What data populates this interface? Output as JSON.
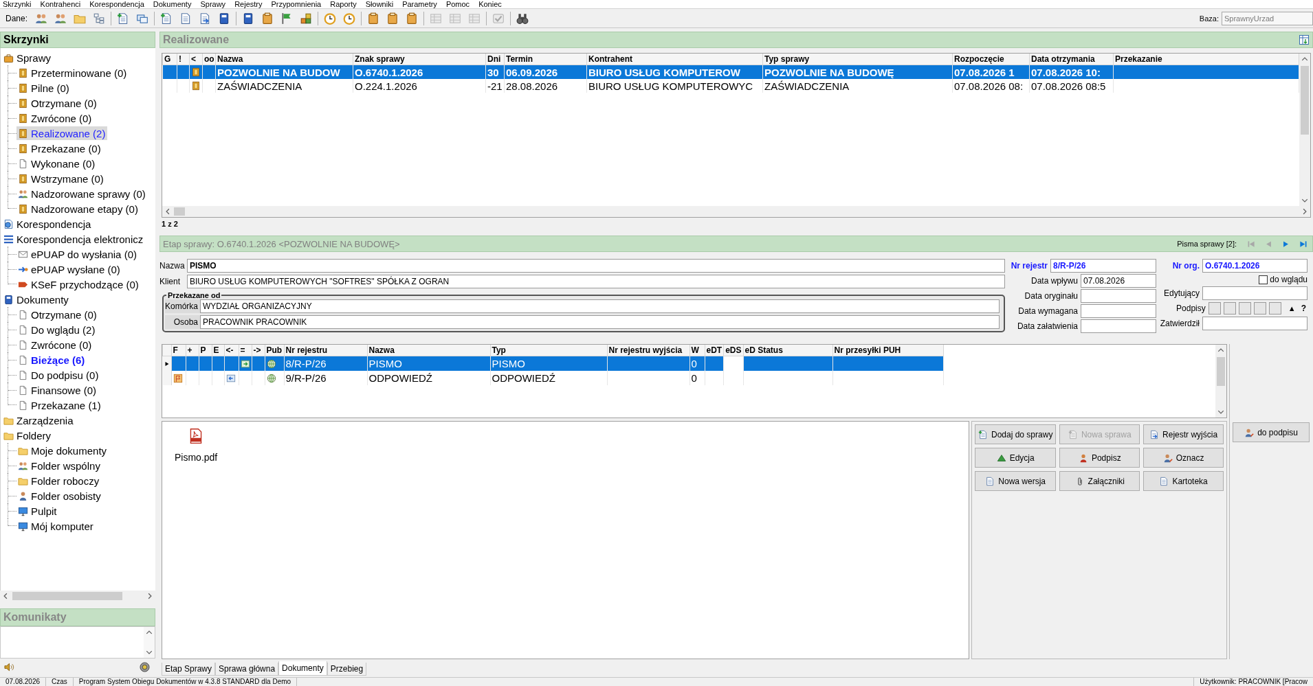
{
  "menu": [
    "Skrzynki",
    "Kontrahenci",
    "Korespondencja",
    "Dokumenty",
    "Sprawy",
    "Rejestry",
    "Przypomnienia",
    "Raporty",
    "Słowniki",
    "Parametry",
    "Pomoc",
    "Koniec"
  ],
  "toolbar": {
    "label": "Dane:",
    "groups": [
      {
        "buttons": [
          {
            "disabled": false
          },
          {
            "disabled": false
          },
          {
            "disabled": false
          },
          {
            "disabled": false
          }
        ]
      },
      {
        "buttons": [
          {
            "disabled": false
          },
          {
            "disabled": false
          }
        ]
      },
      {
        "buttons": [
          {
            "disabled": false
          },
          {
            "disabled": false
          },
          {
            "disabled": false
          },
          {
            "disabled": false
          }
        ]
      },
      {
        "buttons": [
          {
            "disabled": false
          },
          {
            "disabled": false
          },
          {
            "disabled": false
          },
          {
            "disabled": false
          }
        ]
      },
      {
        "buttons": [
          {
            "disabled": false
          },
          {
            "disabled": false
          }
        ]
      },
      {
        "buttons": [
          {
            "disabled": false
          },
          {
            "disabled": false
          },
          {
            "disabled": false
          }
        ]
      },
      {
        "buttons": [
          {
            "disabled": true
          },
          {
            "disabled": true
          },
          {
            "disabled": true
          }
        ]
      },
      {
        "buttons": [
          {
            "disabled": true
          }
        ]
      },
      {
        "buttons": [
          {
            "disabled": false
          }
        ]
      }
    ],
    "database": {
      "label": "Baza:",
      "value": "SprawnyUrzad",
      "disabled": true
    }
  },
  "sidebar": {
    "title": "Skrzynki",
    "tree": [
      {
        "label": "Sprawy",
        "selected": false,
        "bold": false,
        "children": [
          {
            "label": "Przeterminowane (0)",
            "selected": false,
            "bold": false
          },
          {
            "label": "Pilne (0)",
            "selected": false,
            "bold": false
          },
          {
            "label": "Otrzymane (0)",
            "selected": false,
            "bold": false
          },
          {
            "label": "Zwrócone (0)",
            "selected": false,
            "bold": false
          },
          {
            "label": "Realizowane (2)",
            "selected": true,
            "bold": false
          },
          {
            "label": "Przekazane (0)",
            "selected": false,
            "bold": false
          },
          {
            "label": "Wykonane (0)",
            "selected": false,
            "bold": false
          },
          {
            "label": "Wstrzymane (0)",
            "selected": false,
            "bold": false
          },
          {
            "label": "Nadzorowane sprawy (0)",
            "selected": false,
            "bold": false
          },
          {
            "label": "Nadzorowane etapy (0)",
            "selected": false,
            "bold": false
          }
        ]
      },
      {
        "label": "Korespondencja",
        "selected": false,
        "bold": false
      },
      {
        "label": "Korespondencja elektronicz",
        "selected": false,
        "bold": false,
        "children": [
          {
            "label": "ePUAP do wysłania (0)",
            "selected": false,
            "bold": false
          },
          {
            "label": "ePUAP wysłane (0)",
            "selected": false,
            "bold": false
          },
          {
            "label": "KSeF przychodzące (0)",
            "selected": false,
            "bold": false
          }
        ]
      },
      {
        "label": "Dokumenty",
        "selected": false,
        "bold": false,
        "children": [
          {
            "label": "Otrzymane (0)",
            "selected": false,
            "bold": false
          },
          {
            "label": "Do wglądu (2)",
            "selected": false,
            "bold": false
          },
          {
            "label": "Zwrócone (0)",
            "selected": false,
            "bold": false
          },
          {
            "label": "Bieżące (6)",
            "selected": false,
            "bold": true
          },
          {
            "label": "Do podpisu (0)",
            "selected": false,
            "bold": false
          },
          {
            "label": "Finansowe (0)",
            "selected": false,
            "bold": false
          },
          {
            "label": "Przekazane (1)",
            "selected": false,
            "bold": false
          }
        ]
      },
      {
        "label": "Zarządzenia",
        "selected": false,
        "bold": false
      },
      {
        "label": "Foldery",
        "selected": false,
        "bold": false,
        "children": [
          {
            "label": "Moje dokumenty",
            "selected": false,
            "bold": false
          },
          {
            "label": "Folder wspólny",
            "selected": false,
            "bold": false
          },
          {
            "label": "Folder roboczy",
            "selected": false,
            "bold": false
          },
          {
            "label": "Folder osobisty",
            "selected": false,
            "bold": false
          },
          {
            "label": "Pulpit",
            "selected": false,
            "bold": false
          },
          {
            "label": "Mój komputer",
            "selected": false,
            "bold": false
          }
        ]
      }
    ],
    "messages": {
      "title": "Komunikaty"
    }
  },
  "cases": {
    "title": "Realizowane",
    "columns": [
      "G",
      "!",
      "<",
      "oo",
      "Nazwa",
      "Znak sprawy",
      "Dni",
      "Termin",
      "Kontrahent",
      "Typ sprawy",
      "Rozpoczęcie",
      "Data otrzymania",
      "Przekazanie"
    ],
    "rows": [
      {
        "selected": true,
        "name": "POZWOLNIE NA BUDOW",
        "case_number": "O.6740.1.2026",
        "days": "30",
        "deadline": "06.09.2026",
        "contractor": "BIURO USŁUG KOMPUTEROW",
        "case_type": "POZWOLNIE NA BUDOWĘ",
        "started": "07.08.2026 1",
        "received": "07.08.2026 10:"
      },
      {
        "selected": false,
        "name": "ZAŚWIADCZENIA",
        "case_number": "O.224.1.2026",
        "days": "-21",
        "deadline": "28.08.2026",
        "contractor": "BIURO USŁUG KOMPUTEROWYC",
        "case_type": "ZAŚWIADCZENIA",
        "started": "07.08.2026 08:",
        "received": "07.08.2026 08:5"
      }
    ],
    "count": "1 z 2"
  },
  "stage": {
    "title": "Etap sprawy: O.6740.1.2026 <POZWOLNIE NA BUDOWĘ>",
    "letters_label": "Pisma sprawy [2]:",
    "nav": [
      {
        "disabled": true
      },
      {
        "disabled": true
      },
      {
        "disabled": false
      },
      {
        "disabled": false
      }
    ]
  },
  "form": {
    "fields": [
      {
        "label": "Nazwa",
        "value": "PISMO",
        "emphasis": true
      },
      {
        "label": "Klient",
        "value": "BIURO USŁUG KOMPUTEROWYCH \"SOFTRES\" SPÓŁKA Z OGRAN",
        "emphasis": false
      }
    ],
    "group": {
      "title": "Przekazane od",
      "fields": [
        {
          "label": "Komórka",
          "value": "WYDZIAŁ ORGANIZACYJNY"
        },
        {
          "label": "Osoba",
          "value": "PRACOWNIK PRACOWNIK"
        }
      ]
    },
    "dates": [
      {
        "label": "Nr rejestr",
        "value": "8/R-P/26",
        "emphasis": true
      },
      {
        "label": "Data wpływu",
        "value": "07.08.2026",
        "emphasis": false
      },
      {
        "label": "Data oryginału",
        "emphasis": false
      },
      {
        "label": "Data wymagana",
        "emphasis": false
      },
      {
        "label": "Data załatwienia",
        "emphasis": false
      }
    ],
    "side": [
      {
        "kind": "field",
        "label": "Nr org.",
        "value": "O.6740.1.2026",
        "emphasis": true
      },
      {
        "kind": "checkbox",
        "label": "do wglądu",
        "checked": false
      },
      {
        "kind": "field",
        "label": "Edytujący",
        "emphasis": false
      },
      {
        "kind": "signatures",
        "label": "Podpisy",
        "slots": [
          {
            "signed": false
          },
          {
            "signed": false
          },
          {
            "signed": false
          },
          {
            "signed": false
          },
          {
            "signed": false
          }
        ],
        "arrow": "▲",
        "question": "?"
      },
      {
        "kind": "field",
        "label": "Zatwierdził",
        "emphasis": false
      }
    ]
  },
  "documents": {
    "columns": [
      "F",
      "+",
      "P",
      "E",
      "<-",
      "=",
      "->",
      "Pub",
      "Nr rejestru",
      "Nazwa",
      "Typ",
      "Nr rejestru wyjścia",
      "W",
      "eDT",
      "eDS",
      "eD Status",
      "Nr przesyłki PUH"
    ],
    "rows": [
      {
        "selected": true,
        "flagged": false,
        "arrow_in": false,
        "linked": true,
        "published": true,
        "register_no": "8/R-P/26",
        "name": "PISMO",
        "type": "PISMO",
        "w": "0"
      },
      {
        "selected": false,
        "flagged": true,
        "arrow_in": true,
        "linked": false,
        "published": true,
        "register_no": "9/R-P/26",
        "name": "ODPOWIEDŹ",
        "type": "ODPOWIEDŹ",
        "w": "0"
      }
    ]
  },
  "attachments": [
    {
      "name": "Pismo.pdf"
    }
  ],
  "actions": [
    {
      "label": "Dodaj do sprawy",
      "disabled": false
    },
    {
      "label": "Nowa sprawa",
      "disabled": true
    },
    {
      "label": "Rejestr wyjścia",
      "disabled": false
    },
    {
      "label": "Edycja",
      "disabled": false
    },
    {
      "label": "Podpisz",
      "disabled": false
    },
    {
      "label": "Oznacz",
      "disabled": false
    },
    {
      "label": "Nowa wersja",
      "disabled": false
    },
    {
      "label": "Załączniki",
      "disabled": false
    },
    {
      "label": "Kartoteka",
      "disabled": false
    }
  ],
  "side_action": {
    "label": "do podpisu",
    "disabled": false
  },
  "tabs": [
    {
      "label": "Etap Sprawy",
      "selected": false
    },
    {
      "label": "Sprawa główna",
      "selected": false
    },
    {
      "label": "Dokumenty",
      "selected": true
    },
    {
      "label": "Przebieg",
      "selected": false
    }
  ],
  "status_bar": [
    "07.08.2026",
    "Czas",
    "Program System Obiegu Dokumentów w 4.3.8 STANDARD dla Demo",
    "Użytkownik: PRACOWNIK [Pracow"
  ]
}
